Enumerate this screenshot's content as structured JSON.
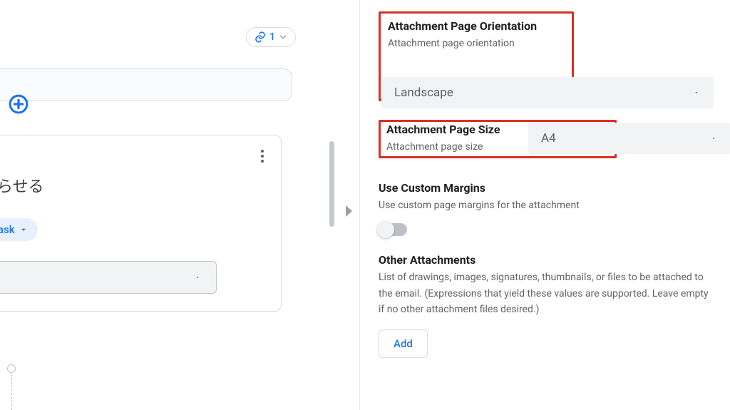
{
  "colors": {
    "primary": "#1a73e8",
    "highlight_border": "#d83025",
    "muted_text": "#5f6368"
  },
  "left": {
    "link_count": "1",
    "jp_title": "知らせる",
    "chip_label": "n a task",
    "chip_truncated_full_hint": "Run a task"
  },
  "right": {
    "orientation": {
      "title": "Attachment Page Orientation",
      "desc": "Attachment page orientation",
      "value": "Landscape"
    },
    "page_size": {
      "title": "Attachment Page Size",
      "desc": "Attachment page size",
      "value": "A4"
    },
    "custom_margins": {
      "title": "Use Custom Margins",
      "desc": "Use custom page margins for the attachment",
      "enabled": false
    },
    "other_attachments": {
      "title": "Other Attachments",
      "desc": "List of drawings, images, signatures, thumbnails, or files to be attached to the email. (Expressions that yield these values are supported. Leave empty if no other attachment files desired.)",
      "add_label": "Add"
    }
  }
}
